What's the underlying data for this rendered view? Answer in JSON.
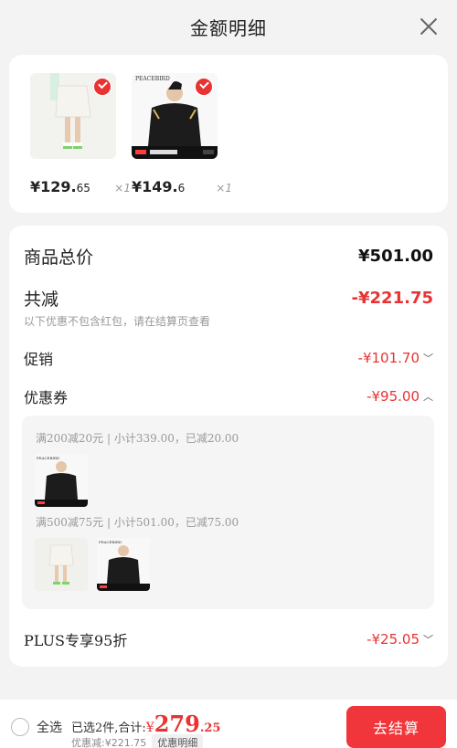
{
  "header": {
    "title": "金额明细"
  },
  "products": [
    {
      "price_main": "¥129.",
      "price_small": "65",
      "qty": "×1"
    },
    {
      "price_main": "¥149.",
      "price_small": "6",
      "qty": "×1"
    }
  ],
  "summary": {
    "total_label": "商品总价",
    "total_value": "¥501.00",
    "discount_label": "共减",
    "discount_value": "-¥221.75",
    "note": "以下优惠不包含红包，请在结算页查看",
    "promo_label": "促销",
    "promo_value": "-¥101.70",
    "coupon_label": "优惠券",
    "coupon_value": "-¥95.00",
    "coupon_line_1": "满200减20元 | 小计339.00，已减20.00",
    "coupon_line_2": "满500减75元 | 小计501.00，已减75.00",
    "plus_label": "PLUS专享95折",
    "plus_value": "-¥25.05"
  },
  "brand": {
    "mark": "PEACEBIRD"
  },
  "bottom": {
    "select_all": "全选",
    "selected_text": "已选2件,合计:",
    "total_yen": "¥",
    "total_int": "279",
    "total_dec": ".25",
    "discounted_text": "优惠减:¥221.75",
    "detail_button": "优惠明细",
    "checkout_button": "去结算"
  },
  "colors": {
    "accent": "#e93232",
    "checkout": "#f0363a"
  }
}
